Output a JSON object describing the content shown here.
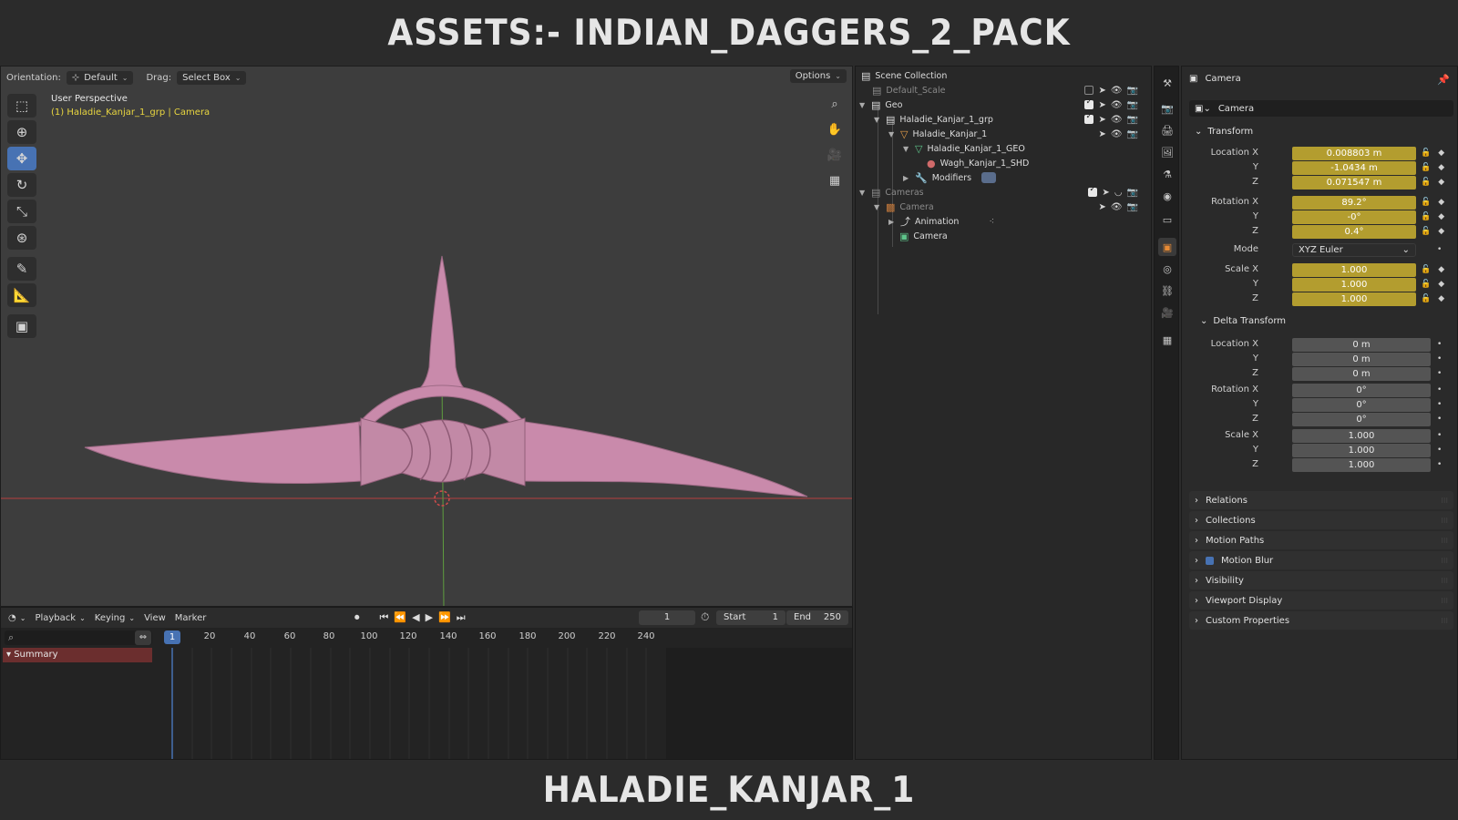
{
  "banner": {
    "top_title": "ASSETS:- INDIAN_DAGGERS_2_PACK",
    "bottom_title": "HALADIE_KANJAR_1"
  },
  "viewport": {
    "orientation_label": "Orientation:",
    "orientation_value": "Default",
    "drag_label": "Drag:",
    "drag_value": "Select Box",
    "options_label": "Options",
    "view_name": "User Perspective",
    "active_object": "(1) Haladie_Kanjar_1_grp | Camera",
    "tools": [
      "select-box-icon",
      "cursor-icon",
      "move-icon",
      "rotate-icon",
      "scale-icon",
      "transform-icon",
      "annotate-icon",
      "measure-icon",
      "add-cube-icon"
    ],
    "nav": [
      "zoom-icon",
      "hand-pan-icon",
      "camera-view-icon",
      "grid-view-icon"
    ],
    "colors": {
      "mesh": "#c98aab",
      "x_axis": "#b8403f",
      "y_axis": "#5f9e3f",
      "active_tool": "#4772b3"
    }
  },
  "timeline": {
    "menus": [
      "Playback",
      "Keying",
      "View",
      "Marker"
    ],
    "current_frame": "1",
    "start_label": "Start",
    "start_value": "1",
    "end_label": "End",
    "end_value": "250",
    "ruler": [
      "1",
      "20",
      "40",
      "60",
      "80",
      "100",
      "120",
      "140",
      "160",
      "180",
      "200",
      "220",
      "240"
    ],
    "summary_label": "Summary"
  },
  "outliner": {
    "rows": [
      {
        "label": "Scene Collection",
        "icon": "collection-icon"
      },
      {
        "label": "Default_Scale",
        "icon": "collection-icon"
      },
      {
        "label": "Geo",
        "icon": "collection-icon"
      },
      {
        "label": "Haladie_Kanjar_1_grp",
        "icon": "collection-icon"
      },
      {
        "label": "Haladie_Kanjar_1",
        "icon": "mesh-object-icon"
      },
      {
        "label": "Haladie_Kanjar_1_GEO",
        "icon": "mesh-data-icon"
      },
      {
        "label": "Wagh_Kanjar_1_SHD",
        "icon": "material-icon"
      },
      {
        "label": "Modifiers",
        "icon": "wrench-icon"
      },
      {
        "label": "Cameras",
        "icon": "collection-icon"
      },
      {
        "label": "Camera",
        "icon": "camera-object-icon"
      },
      {
        "label": "Animation",
        "icon": "animation-icon"
      },
      {
        "label": "Camera",
        "icon": "camera-data-icon"
      }
    ]
  },
  "properties": {
    "header": "Camera",
    "object_name": "Camera",
    "transform": {
      "title": "Transform",
      "location_label": "Location X",
      "location": [
        "0.008803 m",
        "-1.0434 m",
        "0.071547 m"
      ],
      "rotation_label": "Rotation X",
      "rotation": [
        "89.2°",
        "-0°",
        "0.4°"
      ],
      "mode_label": "Mode",
      "mode_value": "XYZ Euler",
      "scale_label": "Scale X",
      "scale": [
        "1.000",
        "1.000",
        "1.000"
      ],
      "axis_y": "Y",
      "axis_z": "Z"
    },
    "delta": {
      "title": "Delta Transform",
      "location_label": "Location X",
      "location": [
        "0 m",
        "0 m",
        "0 m"
      ],
      "rotation_label": "Rotation X",
      "rotation": [
        "0°",
        "0°",
        "0°"
      ],
      "scale_label": "Scale X",
      "scale": [
        "1.000",
        "1.000",
        "1.000"
      ]
    },
    "sections": [
      "Relations",
      "Collections",
      "Motion Paths",
      "Motion Blur",
      "Visibility",
      "Viewport Display",
      "Custom Properties"
    ]
  }
}
